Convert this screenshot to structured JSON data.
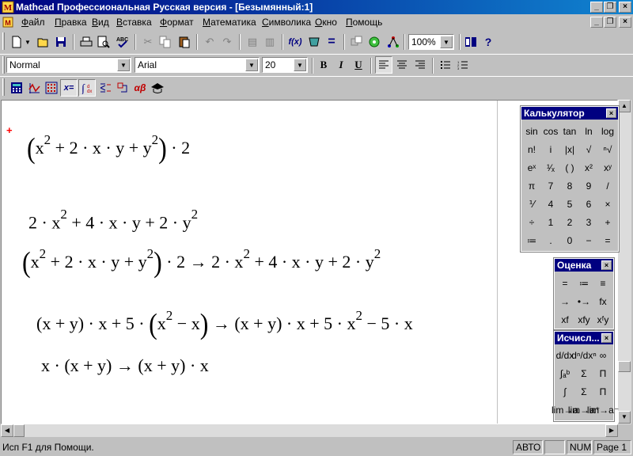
{
  "window": {
    "title": "Mathcad Профессиональная Русская версия - [Безымянный:1]",
    "caption_buttons": {
      "minimize": "_",
      "restore": "❐",
      "close": "×"
    },
    "doc_buttons": {
      "minimize": "_",
      "restore": "❐",
      "close": "×"
    }
  },
  "menu": {
    "items": [
      {
        "key": "Ф",
        "rest": "айл"
      },
      {
        "key": "П",
        "rest": "равка"
      },
      {
        "key": "В",
        "rest": "ид"
      },
      {
        "key": "В",
        "rest": "ставка"
      },
      {
        "key": "Ф",
        "rest": "ормат"
      },
      {
        "key": "М",
        "rest": "атематика"
      },
      {
        "key": "С",
        "rest": "имволика"
      },
      {
        "key": "О",
        "rest": "кно"
      },
      {
        "key": "П",
        "rest": "омощь"
      }
    ]
  },
  "toolbar_standard": {
    "zoom": "100%",
    "icons": {
      "new": "new-icon",
      "open": "open-icon",
      "save": "save-icon",
      "print": "print-icon",
      "preview": "preview-icon",
      "spell": "spell-check-icon",
      "cut": "cut-icon",
      "copy": "copy-icon",
      "paste": "paste-icon",
      "undo": "undo-icon",
      "redo": "redo-icon",
      "align_h": "align-horizontal-icon",
      "align_v": "align-vertical-icon",
      "insert_function": "insert-function-icon",
      "insert_unit": "insert-unit-icon",
      "calculate": "calculate-icon",
      "component": "component-icon",
      "resources": "resources-icon",
      "help": "help-icon"
    },
    "fx": "f(x)",
    "eq": "="
  },
  "toolbar_format": {
    "style": "Normal",
    "font": "Arial",
    "size": "20",
    "bold": "B",
    "italic": "I",
    "underline": "U"
  },
  "toolbar_math": {
    "labels": {
      "eval": "x=",
      "greek": "αβ"
    }
  },
  "document": {
    "expressions": [
      {
        "pre": "",
        "open": "(",
        "body": "x<sup>2</sup> + 2 · x · y + y<sup>2</sup>",
        "close": ")",
        "post": " · 2"
      },
      {
        "plain": "2 · x<sup>2</sup> + 4 · x · y + 2 · y<sup>2</sup>"
      },
      {
        "pre": "",
        "open": "(",
        "body": "x<sup>2</sup> + 2 · x · y + y<sup>2</sup>",
        "close": ")",
        "post": " · 2  → 2 · x<sup>2</sup> + 4 · x · y + 2 · y<sup>2</sup>"
      },
      {
        "pre": "(x + y) · x + 5 · ",
        "open": "(",
        "body": "x<sup>2</sup> − x",
        "close": ")",
        "post": " → (x + y) · x + 5 · x<sup>2</sup> − 5 · x"
      },
      {
        "plain": "x · (x + y) → (x + y) · x"
      }
    ]
  },
  "calculator": {
    "title": "Калькулятор",
    "keys": [
      "sin",
      "cos",
      "tan",
      "ln",
      "log",
      "n!",
      "i",
      "|x|",
      "√",
      "ⁿ√",
      "eˣ",
      "¹⁄ₓ",
      "( )",
      "x²",
      "xʸ",
      "π",
      "7",
      "8",
      "9",
      "/",
      "⅟",
      "4",
      "5",
      "6",
      "×",
      "÷",
      "1",
      "2",
      "3",
      "+",
      "≔",
      ".",
      "0",
      "−",
      "="
    ]
  },
  "evaluation": {
    "title": "Оценка",
    "keys": [
      "=",
      "≔",
      "≡",
      "→",
      "•→",
      "fx",
      "xf",
      "xfy",
      "xᶠy"
    ]
  },
  "calculus": {
    "title": "Исчисл...",
    "keys": [
      "d/dx",
      "dⁿ/dxⁿ",
      "∞",
      "∫ₐᵇ",
      "Σ",
      "Π",
      "∫",
      "Σ",
      "Π",
      "lim→a",
      "lim→a⁺",
      "lim→a⁻"
    ]
  },
  "statusbar": {
    "message": "Исп F1 для Помощи.",
    "mode": "АВТО",
    "num": "NUM",
    "page": "Page 1"
  }
}
